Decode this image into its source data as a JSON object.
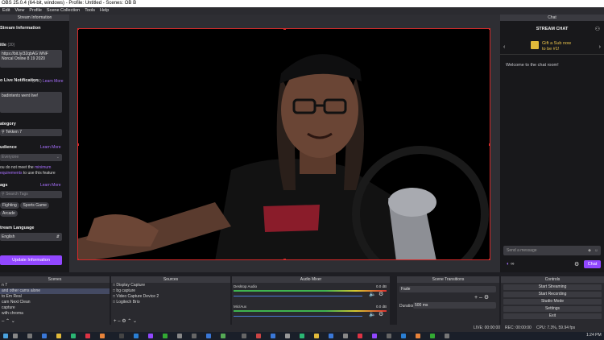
{
  "window": {
    "title": "OBS 25.0.4 (64-bit, windows) - Profile: Untitled - Scenes: OB B"
  },
  "menu": [
    "Edit",
    "View",
    "Profile",
    "Scene Collection",
    "Tools",
    "Help"
  ],
  "stream_info": {
    "panel_title": "Stream Information",
    "heading": "Stream Information",
    "title_label": "itle",
    "title_count": "(30)",
    "title_value": "https://bit.ly/32qbAG WNF Norcal Online 8 19 2020",
    "golive_label": "o Live Notification",
    "golive_count": "(140)",
    "golive_link": "Learn More",
    "golive_value": "badintentx went live!",
    "category_label": "ategory",
    "category_value": "Tekken 7",
    "audience_label": "udience",
    "audience_link": "Learn More",
    "audience_value": "Everyone",
    "audience_note_1": "ou do not meet the ",
    "audience_note_link": "minimum",
    "audience_note_2": "equirements",
    "audience_note_3": " to use this feature",
    "tags_label": "ags",
    "tags_link": "Learn More",
    "tags_placeholder": "Search Tags",
    "tags": [
      "Fighting",
      "Sports Game",
      "Arcade"
    ],
    "language_label": "tream Language",
    "language_value": "English",
    "update_button": "Update Information"
  },
  "chat": {
    "panel_title": "Chat",
    "header": "STREAM CHAT",
    "promo_line1": "Gift a Sub now",
    "promo_line2": "to be #1!",
    "welcome": "Welcome to the chat room!",
    "input_placeholder": "Send a message",
    "points": "∞",
    "chat_button": "Chat"
  },
  "docks": {
    "scenes": {
      "title": "Scenes",
      "items": [
        "n 7",
        "and other cams alone",
        "to Em Real",
        "cam Next Clean",
        "capture",
        "with chroma"
      ],
      "selected_index": 1
    },
    "sources": {
      "title": "Sources",
      "items": [
        "Display Capture",
        "bg capture",
        "Video Capture Device 2",
        "Logitech Brio"
      ]
    },
    "mixer": {
      "title": "Audio Mixer",
      "channels": [
        {
          "name": "Desktop Audio",
          "db": "0.0 dB"
        },
        {
          "name": "Mic/Aux",
          "db": "0.0 dB"
        }
      ]
    },
    "transitions": {
      "title": "Scene Transitions",
      "type": "Fade",
      "duration_label": "Duration",
      "duration_value": "500 ms"
    },
    "controls": {
      "title": "Controls",
      "buttons": [
        "Start Streaming",
        "Start Recording",
        "Studio Mode",
        "Settings",
        "Exit"
      ]
    }
  },
  "status": {
    "live": "LIVE: 00:00:00",
    "rec": "REC: 00:00:00",
    "cpu": "CPU: 7.3%, 59.94 fps"
  },
  "taskbar": {
    "time": "1:24 PM"
  },
  "colors": {
    "accent": "#9147ff",
    "selection_border": "#d42a2a"
  }
}
